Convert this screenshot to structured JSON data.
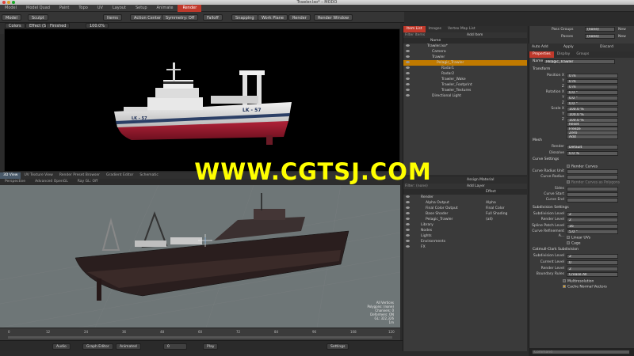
{
  "window": {
    "title": "Trawler.lxo* – MODO"
  },
  "menu": [
    "Model",
    "Model Quad",
    "Paint",
    "Topo",
    "UV",
    "Layout",
    "Setup",
    "Animate",
    "Render"
  ],
  "menu_active": 8,
  "toolbar": {
    "model": "Model",
    "sculpt": "Sculpt",
    "items": "Items",
    "action_center": "Action Center",
    "symmetry": "Symmetry: Off",
    "falloff": "Falloff",
    "snapping": "Snapping",
    "work_plane": "Work Plane",
    "render": "Render",
    "render_window": "Render Window"
  },
  "subbar": [
    "Colors",
    "Effect (Shade...)",
    "Finished",
    "100.0%",
    "(Render Camera)",
    "IC: Update"
  ],
  "viewport_top": {
    "ship_label": "LK - 57"
  },
  "bottom_tabs": [
    "3D View",
    "UV Texture View",
    "Render Preset Browser",
    "Gradient Editor",
    "Schematic"
  ],
  "bottom_active": 0,
  "bottom_sub": [
    "Perspective",
    "Advanced OpenGL",
    "Ray GL: Off"
  ],
  "viewport_info": [
    "All Vertices",
    "Polygons: (none)",
    "Channels: 0",
    "Deformers: ON",
    "GL: 322,326",
    "1m"
  ],
  "timeline": {
    "ticks": [
      "0",
      "12",
      "24",
      "36",
      "48",
      "60",
      "72",
      "84",
      "96",
      "108",
      "120"
    ]
  },
  "statusbar": {
    "audio": "Audio",
    "graph_editor": "Graph Editor",
    "animated": "Animated",
    "frame": "0",
    "play": "Play",
    "settings": "Settings"
  },
  "item_list": {
    "tabs": [
      "Item List",
      "Images",
      "Vertex Map List"
    ],
    "filter": "Filter Items",
    "add_item": "Add Item",
    "col_name": "Name",
    "rows": [
      {
        "name": "Trawler.lxo*",
        "indent": 0
      },
      {
        "name": "Camera",
        "indent": 1
      },
      {
        "name": "Trawler",
        "indent": 1
      },
      {
        "name": "Pelagic_Trawler",
        "indent": 2,
        "selected": true
      },
      {
        "name": "Radar1",
        "indent": 3
      },
      {
        "name": "Radar2",
        "indent": 3
      },
      {
        "name": "Trawler_Wake",
        "indent": 3
      },
      {
        "name": "Trawler_Footprint",
        "indent": 3
      },
      {
        "name": "Trawler_Textures",
        "indent": 3
      },
      {
        "name": "Directional Light",
        "indent": 1
      }
    ]
  },
  "shader_tree": {
    "assign": "Assign Material",
    "filter": "Filter: (none)",
    "add_layer": "Add Layer",
    "col_effect": "Effect",
    "rows": [
      {
        "name": "Render",
        "effect": "",
        "indent": 0
      },
      {
        "name": "Alpha Output",
        "effect": "Alpha",
        "indent": 1
      },
      {
        "name": "Final Color Output",
        "effect": "Final Color",
        "indent": 1
      },
      {
        "name": "Base Shader",
        "effect": "Full Shading",
        "indent": 1
      },
      {
        "name": "Pelagic_Trawler",
        "effect": "(all)",
        "indent": 1
      },
      {
        "name": "Library",
        "effect": "",
        "indent": 0
      },
      {
        "name": "Nodes",
        "effect": "",
        "indent": 0
      },
      {
        "name": "Lights",
        "effect": "",
        "indent": 0
      },
      {
        "name": "Environments",
        "effect": "",
        "indent": 0
      },
      {
        "name": "FX",
        "effect": "",
        "indent": 0
      }
    ]
  },
  "pass_groups": {
    "pass_groups": "Pass Groups",
    "passes": "Passes",
    "none": "(none)",
    "new": "New"
  },
  "actions": {
    "auto_add": "Auto Add",
    "apply": "Apply",
    "discard": "Discard"
  },
  "properties": {
    "tabs": [
      "Properties",
      "Display",
      "Groups"
    ],
    "name_label": "Name",
    "name_value": "Pelagic_Trawler",
    "transform": "Transform",
    "position_x": "Position X",
    "rotation_x": "Rotation X",
    "scale_x": "Scale X",
    "y": "Y",
    "z": "Z",
    "pos": [
      "0 m",
      "0 m",
      "0 m"
    ],
    "rot": [
      "0.0 °",
      "0.0 °",
      "0.0 °"
    ],
    "scl": [
      "100.0 %",
      "100.0 %",
      "100.0 %"
    ],
    "reset": "Reset",
    "freeze": "Freeze",
    "zero": "Zero",
    "add": "Add",
    "mesh": "Mesh",
    "render_label": "Render",
    "render_value": "Default",
    "dissolve_label": "Dissolve",
    "dissolve_value": "0.0 %",
    "curve_settings": "Curve Settings",
    "render_curves": "Render Curves",
    "curve_radius_unit": "Curve Radius Unit",
    "curve_radius": "Curve Radius",
    "render_curves_polygons": "Render Curves as Polygons",
    "sides": "Sides",
    "curve_start": "Curve Start",
    "curve_end": "Curve End",
    "subdiv_settings": "Subdivision Settings",
    "subdiv_level": "Subdivision Level",
    "subdiv_level_value": "2",
    "render_level": "Render Level",
    "render_level_value": "2",
    "spline_patch": "Spline Patch Level",
    "spline_patch_value": "16",
    "curve_refinement": "Curve Refinement A...",
    "curve_refinement_value": "5.0 °",
    "linear_uvs": "Linear UVs",
    "cage": "Cage",
    "catmull": "Catmull-Clark Subdivision",
    "cc_subdiv_level": "Subdivision Level",
    "cc_subdiv_value": "2",
    "current_level": "Current Level",
    "current_level_value": "0",
    "cc_render_level": "Render Level",
    "cc_render_value": "2",
    "boundary_rules": "Boundary Rules",
    "boundary_value": "Crease All",
    "multiresolution": "Multiresolution",
    "cache_normal": "Cache Normal Vectors",
    "command": "Command"
  },
  "watermark": "WWW.CGTSJ.COM",
  "colors": {
    "accent": "#c0392b",
    "selected_row": "#c07a00",
    "watermark": "#ffff00"
  }
}
